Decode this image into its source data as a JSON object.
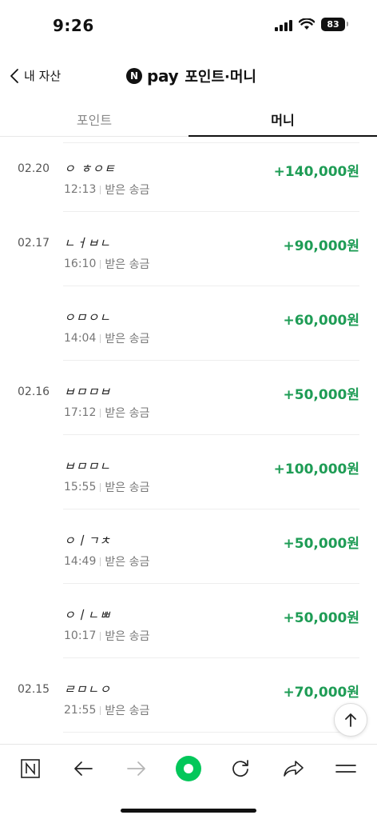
{
  "status_bar": {
    "time": "9:26",
    "battery": "83"
  },
  "header": {
    "back_label": "내 자산",
    "n_badge": "N",
    "title_pay": "pay",
    "title_text": "포인트·머니"
  },
  "tabs": [
    {
      "label": "포인트",
      "active": false
    },
    {
      "label": "머니",
      "active": true
    }
  ],
  "transactions": [
    {
      "date": "02.20",
      "name": "ㅇ ㅎㅇㅌ",
      "time": "12:13",
      "type": "받은 송금",
      "amount": "+140,000원"
    },
    {
      "date": "02.17",
      "name": "ㄴㅓㅂㄴ",
      "time": "16:10",
      "type": "받은 송금",
      "amount": "+90,000원"
    },
    {
      "date": "",
      "name": "ㅇㅁㅇㄴ",
      "time": "14:04",
      "type": "받은 송금",
      "amount": "+60,000원"
    },
    {
      "date": "02.16",
      "name": "ㅂㅁㅁㅂ",
      "time": "17:12",
      "type": "받은 송금",
      "amount": "+50,000원"
    },
    {
      "date": "",
      "name": "ㅂㅁㅁㄴ",
      "time": "15:55",
      "type": "받은 송금",
      "amount": "+100,000원"
    },
    {
      "date": "",
      "name": "ㅇㅣㄱㅊ",
      "time": "14:49",
      "type": "받은 송금",
      "amount": "+50,000원"
    },
    {
      "date": "",
      "name": "ㅇㅣㄴㅃ",
      "time": "10:17",
      "type": "받은 송금",
      "amount": "+50,000원"
    },
    {
      "date": "02.15",
      "name": "ㄹㅁㄴㅇ",
      "time": "21:55",
      "type": "받은 송금",
      "amount": "+70,000원"
    }
  ],
  "toolbar": {
    "items": [
      "naver-home-icon",
      "back-arrow-icon",
      "forward-arrow-icon",
      "green-dot-icon",
      "refresh-icon",
      "share-icon",
      "menu-icon"
    ]
  },
  "colors": {
    "amount_green": "#1e9c55",
    "accent_green": "#03c75a"
  }
}
